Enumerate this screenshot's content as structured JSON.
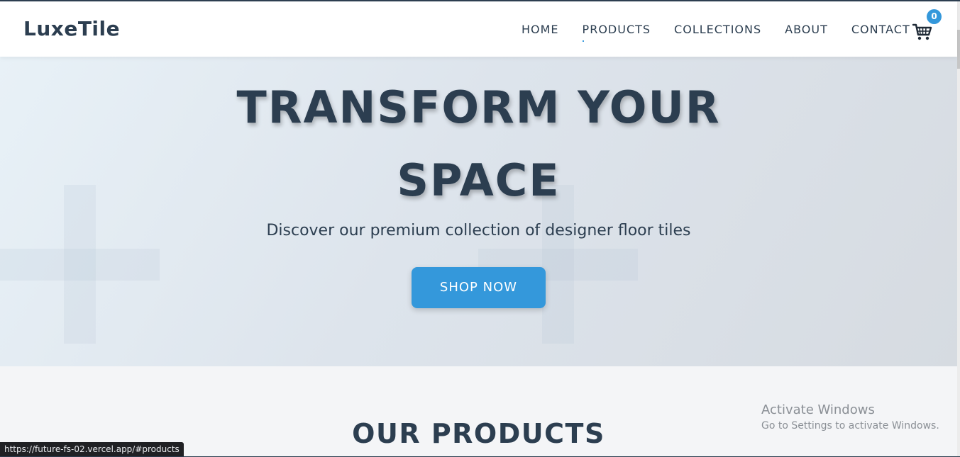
{
  "header": {
    "logo": "LuxeTile",
    "nav": [
      {
        "label": "HOME"
      },
      {
        "label": "PRODUCTS"
      },
      {
        "label": "COLLECTIONS"
      },
      {
        "label": "ABOUT"
      },
      {
        "label": "CONTACT"
      }
    ],
    "active_nav": "PRODUCTS",
    "cart": {
      "icon": "cart-icon",
      "count": "0"
    }
  },
  "hero": {
    "title_line1": "TRANSFORM YOUR",
    "title_line2": "SPACE",
    "subtitle": "Discover our premium collection of designer floor tiles",
    "cta_label": "SHOP NOW"
  },
  "products": {
    "title": "OUR PRODUCTS"
  },
  "overlay": {
    "activate_title": "Activate Windows",
    "activate_sub": "Go to Settings to activate Windows."
  },
  "status_bar": {
    "url": "https://future-fs-02.vercel.app/#products"
  },
  "colors": {
    "primary_text": "#2c3e50",
    "accent": "#3498db",
    "hero_bg_start": "#e8f1f7",
    "hero_bg_end": "#d6dbe1",
    "section_bg": "#f4f5f7"
  }
}
